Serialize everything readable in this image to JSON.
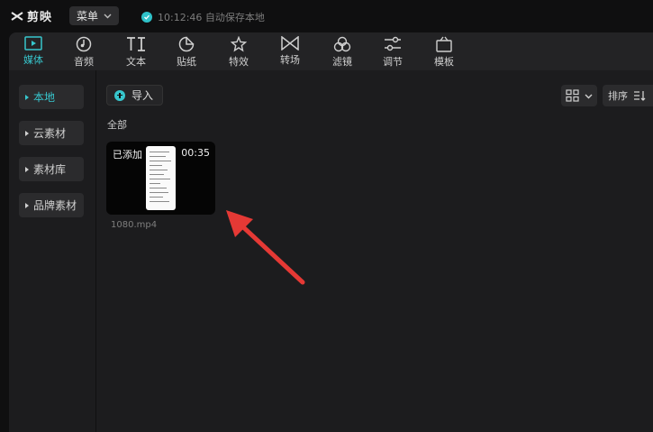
{
  "app": {
    "name": "剪映",
    "menu_label": "菜单",
    "autosave_text": "10:12:46 自动保存本地"
  },
  "toolbar": {
    "tabs": [
      {
        "label": "媒体",
        "icon": "media-icon",
        "active": true
      },
      {
        "label": "音频",
        "icon": "audio-icon"
      },
      {
        "label": "文本",
        "icon": "text-icon"
      },
      {
        "label": "贴纸",
        "icon": "sticker-icon"
      },
      {
        "label": "特效",
        "icon": "effects-icon"
      },
      {
        "label": "转场",
        "icon": "transition-icon"
      },
      {
        "label": "滤镜",
        "icon": "filter-icon"
      },
      {
        "label": "调节",
        "icon": "adjust-icon"
      },
      {
        "label": "模板",
        "icon": "template-icon"
      }
    ]
  },
  "sidebar": {
    "items": [
      {
        "label": "本地",
        "active": true
      },
      {
        "label": "云素材"
      },
      {
        "label": "素材库"
      },
      {
        "label": "品牌素材"
      }
    ]
  },
  "content": {
    "import_label": "导入",
    "sort_label": "排序",
    "section_label": "全部",
    "media": [
      {
        "status": "已添加",
        "duration": "00:35",
        "filename": "1080.mp4"
      }
    ]
  },
  "colors": {
    "accent": "#37c6cd",
    "annotation_arrow": "#e53935"
  }
}
